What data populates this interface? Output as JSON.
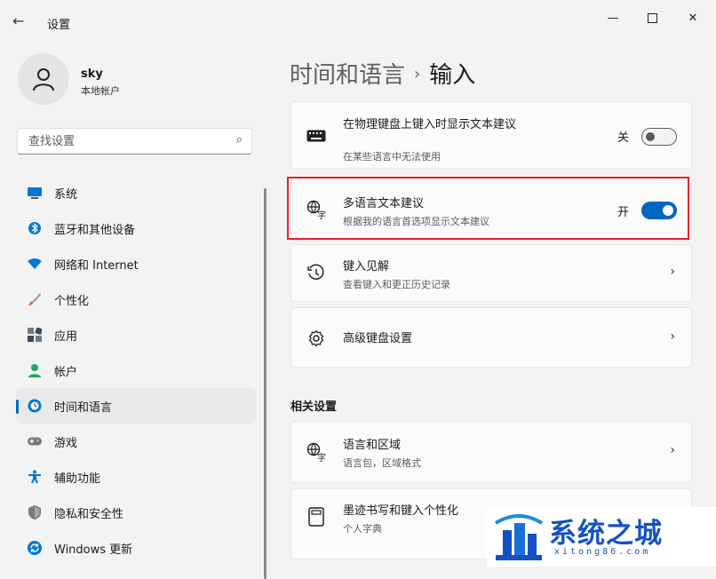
{
  "window": {
    "title": "设置"
  },
  "user": {
    "name": "sky",
    "account_type": "本地帐户"
  },
  "search": {
    "placeholder": "查找设置"
  },
  "nav": [
    {
      "label": "系统",
      "icon": "monitor-icon",
      "color": "#0078d4"
    },
    {
      "label": "蓝牙和其他设备",
      "icon": "bluetooth-icon",
      "color": "#0078d4"
    },
    {
      "label": "网络和 Internet",
      "icon": "wifi-icon",
      "color": "#0078d4"
    },
    {
      "label": "个性化",
      "icon": "brush-icon",
      "color": "#e0743b"
    },
    {
      "label": "应用",
      "icon": "apps-icon",
      "color": "#3a4a5c"
    },
    {
      "label": "帐户",
      "icon": "account-icon",
      "color": "#2aa36b"
    },
    {
      "label": "时间和语言",
      "icon": "globe-clock-icon",
      "color": "#0078d4",
      "active": true
    },
    {
      "label": "游戏",
      "icon": "gamepad-icon",
      "color": "#7a7a7a"
    },
    {
      "label": "辅助功能",
      "icon": "accessibility-icon",
      "color": "#0078d4"
    },
    {
      "label": "隐私和安全性",
      "icon": "shield-icon",
      "color": "#7a7a7a"
    },
    {
      "label": "Windows 更新",
      "icon": "update-icon",
      "color": "#0078d4"
    }
  ],
  "breadcrumb": {
    "parent": "时间和语言",
    "separator": "›",
    "current": "输入"
  },
  "cards": {
    "physical_kb": {
      "title": "在物理键盘上键入时显示文本建议",
      "subtitle": "在某些语言中无法使用",
      "state_label": "关",
      "on": false
    },
    "multilingual": {
      "title": "多语言文本建议",
      "subtitle": "根据我的语言首选项显示文本建议",
      "state_label": "开",
      "on": true
    },
    "typing_insights": {
      "title": "键入见解",
      "subtitle": "查看键入和更正历史记录"
    },
    "advanced_kb": {
      "title": "高级键盘设置"
    }
  },
  "related": {
    "title": "相关设置",
    "items": [
      {
        "title": "语言和区域",
        "subtitle": "语言包，区域格式"
      },
      {
        "title": "墨迹书写和键入个性化",
        "subtitle": "个人字典"
      }
    ]
  },
  "watermark": {
    "name": "系统之城",
    "url": "xitong86.com"
  },
  "colors": {
    "accent": "#0067c0",
    "highlight": "#e8232b",
    "watermark": "#1551c4"
  }
}
